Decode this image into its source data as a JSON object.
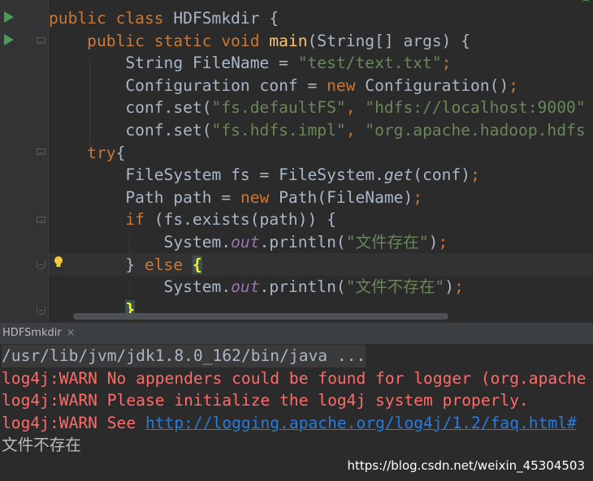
{
  "editor": {
    "lines": [
      {
        "parts": [
          {
            "t": "public class ",
            "c": "kw"
          },
          {
            "t": "HDFSmkdir {",
            "c": ""
          }
        ]
      },
      {
        "parts": [
          {
            "t": "    public static void ",
            "c": "kw"
          },
          {
            "t": "main",
            "c": "fn"
          },
          {
            "t": "(String[] args) {",
            "c": ""
          }
        ]
      },
      {
        "parts": [
          {
            "t": "        String FileName = ",
            "c": ""
          },
          {
            "t": "\"test/text.txt\"",
            "c": "str"
          },
          {
            "t": ";",
            "c": "kw"
          }
        ]
      },
      {
        "parts": [
          {
            "t": "        Configuration conf = ",
            "c": ""
          },
          {
            "t": "new ",
            "c": "kw"
          },
          {
            "t": "Configuration()",
            "c": ""
          },
          {
            "t": ";",
            "c": "kw"
          }
        ]
      },
      {
        "parts": [
          {
            "t": "        conf.set(",
            "c": ""
          },
          {
            "t": "\"fs.defaultFS\"",
            "c": "str"
          },
          {
            "t": ", ",
            "c": "kw"
          },
          {
            "t": "\"hdfs://localhost:9000\"",
            "c": "str"
          }
        ]
      },
      {
        "parts": [
          {
            "t": "        conf.set(",
            "c": ""
          },
          {
            "t": "\"fs.hdfs.impl\"",
            "c": "str"
          },
          {
            "t": ", ",
            "c": "kw"
          },
          {
            "t": "\"org.apache.hadoop.hdfs",
            "c": "str"
          }
        ]
      },
      {
        "parts": [
          {
            "t": "    try",
            "c": "kw"
          },
          {
            "t": "{",
            "c": ""
          }
        ]
      },
      {
        "parts": [
          {
            "t": "        FileSystem fs = FileSystem.",
            "c": ""
          },
          {
            "t": "get",
            "c": "it"
          },
          {
            "t": "(conf)",
            "c": ""
          },
          {
            "t": ";",
            "c": "kw"
          }
        ]
      },
      {
        "parts": [
          {
            "t": "        Path path = ",
            "c": ""
          },
          {
            "t": "new ",
            "c": "kw"
          },
          {
            "t": "Path(FileName)",
            "c": ""
          },
          {
            "t": ";",
            "c": "kw"
          }
        ]
      },
      {
        "parts": [
          {
            "t": "        if ",
            "c": "kw"
          },
          {
            "t": "(fs.exists(path)) {",
            "c": ""
          }
        ]
      },
      {
        "parts": [
          {
            "t": "            System.",
            "c": ""
          },
          {
            "t": "out",
            "c": "field"
          },
          {
            "t": ".println(",
            "c": ""
          },
          {
            "t": "\"文件存在\"",
            "c": "str"
          },
          {
            "t": ")",
            "c": ""
          },
          {
            "t": ";",
            "c": "kw"
          }
        ]
      },
      {
        "parts": [
          {
            "t": "        } ",
            "c": ""
          },
          {
            "t": "else ",
            "c": "kw"
          },
          {
            "t": "{",
            "c": "brace-match"
          }
        ]
      },
      {
        "parts": [
          {
            "t": "            System.",
            "c": ""
          },
          {
            "t": "out",
            "c": "field"
          },
          {
            "t": ".println(",
            "c": ""
          },
          {
            "t": "\"文件不存在\"",
            "c": "str"
          },
          {
            "t": ")",
            "c": ""
          },
          {
            "t": ";",
            "c": "kw"
          }
        ]
      },
      {
        "parts": [
          {
            "t": "        ",
            "c": ""
          },
          {
            "t": "}",
            "c": "brace-match"
          }
        ]
      }
    ]
  },
  "run_panel": {
    "tab_label": "HDFSmkdir",
    "tab_close": "×",
    "lines": [
      {
        "text": "/usr/lib/jvm/jdk1.8.0_162/bin/java ...",
        "kind": "cmd"
      },
      {
        "text": "log4j:WARN No appenders could be found for logger (org.apache",
        "kind": "warn"
      },
      {
        "text": "log4j:WARN Please initialize the log4j system properly.",
        "kind": "warn"
      },
      {
        "text": "log4j:WARN See ",
        "kind": "warn",
        "link": "http://logging.apache.org/log4j/1.2/faq.html#"
      },
      {
        "text": "文件不存在",
        "kind": "out"
      }
    ]
  },
  "watermark": "https://blog.csdn.net/weixin_45304503",
  "colors": {
    "keyword": "#cc7832",
    "string": "#6a8759",
    "function": "#ffc66d",
    "warning": "#ff6b68",
    "link": "#287bde"
  }
}
